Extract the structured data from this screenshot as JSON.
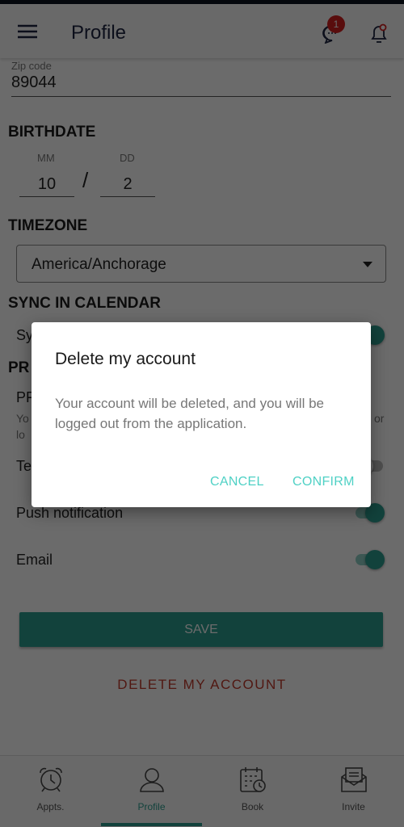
{
  "header": {
    "title": "Profile",
    "messages_badge": "1"
  },
  "form": {
    "zip_label": "Zip code",
    "zip_value": "89044",
    "birthdate_label": "BIRTHDATE",
    "mm_label": "MM",
    "dd_label": "DD",
    "mm_value": "10",
    "dd_value": "2",
    "separator": "/",
    "timezone_label": "TIMEZONE",
    "timezone_value": "America/Anchorage",
    "sync_label": "SYNC IN CALENDAR",
    "sync_item": "Sy",
    "section2_label": "PR",
    "item1_title": "PF",
    "item1_desc_a": "Yo",
    "item1_desc_b": "or",
    "item1_desc_c": "lo",
    "item2": "Te",
    "push_label": "Push notification",
    "email_label": "Email",
    "toggles": {
      "sync": true,
      "te": false,
      "push": true,
      "email": true
    },
    "save_label": "SAVE",
    "delete_label": "DELETE MY ACCOUNT"
  },
  "dialog": {
    "title": "Delete my account",
    "message": "Your account will be deleted, and you will be logged out from the application.",
    "cancel": "CANCEL",
    "confirm": "CONFIRM"
  },
  "nav": {
    "items": [
      {
        "label": "Appts.",
        "icon": "alarm-clock-icon"
      },
      {
        "label": "Profile",
        "icon": "user-icon",
        "active": true
      },
      {
        "label": "Book",
        "icon": "calendar-clock-icon"
      },
      {
        "label": "Invite",
        "icon": "envelope-icon"
      }
    ]
  },
  "colors": {
    "accent": "#2a9d8f",
    "danger": "#c0392b",
    "dialog_button": "#4fd1c5",
    "badge": "#d42020"
  }
}
